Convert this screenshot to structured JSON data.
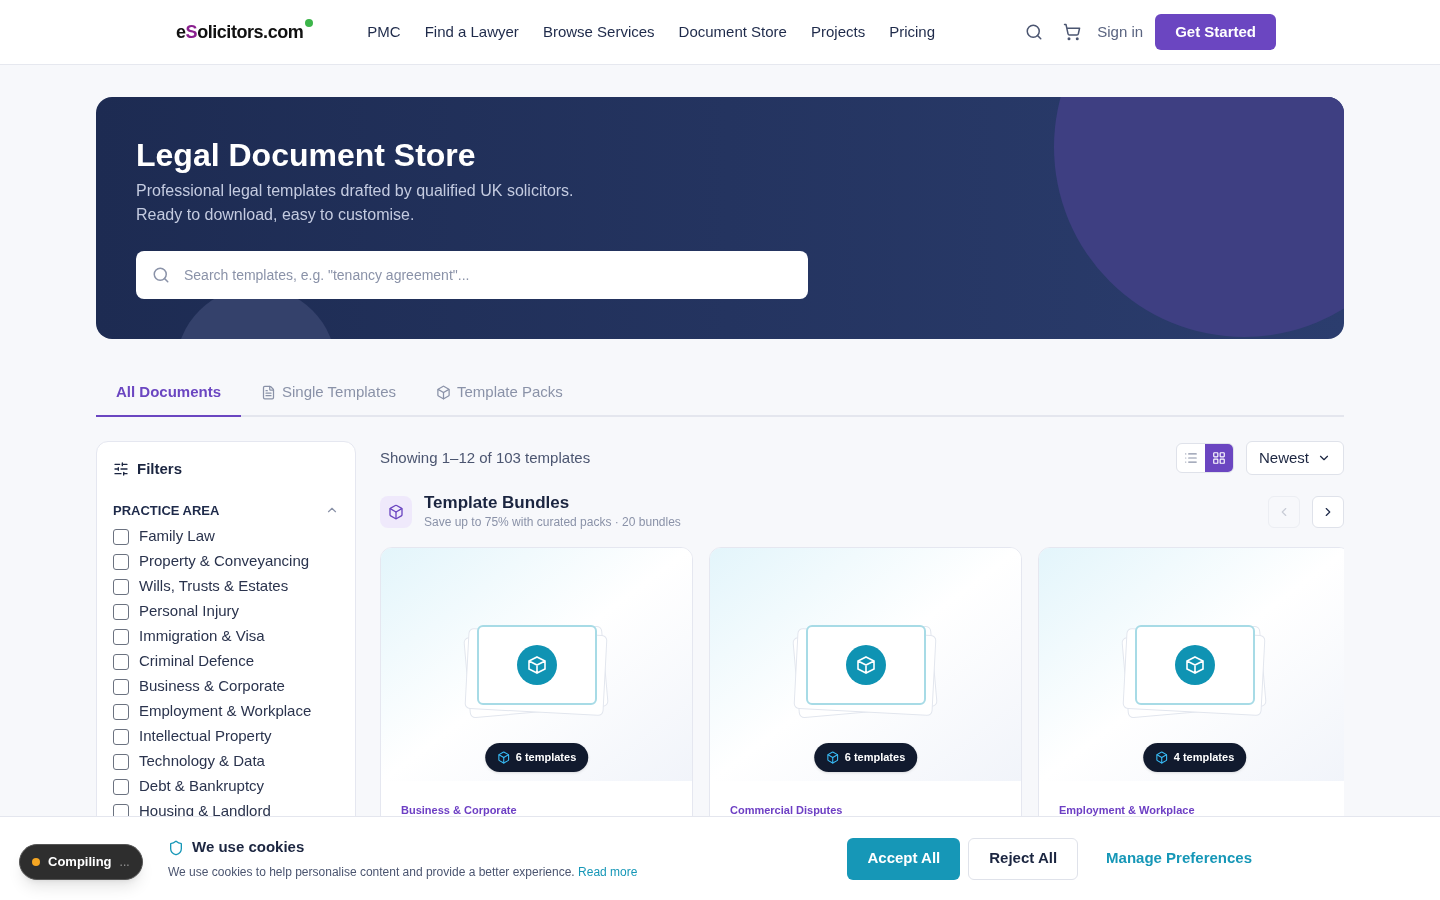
{
  "header": {
    "logo": {
      "start": "e",
      "accent": "S",
      "end": "olicitors.com"
    },
    "nav": [
      "PMC",
      "Find a Lawyer",
      "Browse Services",
      "Document Store",
      "Projects",
      "Pricing"
    ],
    "sign_in": "Sign in",
    "cta": "Get Started"
  },
  "hero": {
    "title": "Legal Document Store",
    "subtitle": [
      "Professional legal templates drafted by qualified UK solicitors.",
      "Ready to download, easy to customise."
    ],
    "search": {
      "placeholder": "Search templates, e.g. \"tenancy agreement\"..."
    }
  },
  "tabs": [
    {
      "label": "All Documents",
      "kind": "all",
      "selected": true
    },
    {
      "label": "Single Templates",
      "kind": "single",
      "selected": false
    },
    {
      "label": "Template Packs",
      "kind": "pack",
      "selected": false
    }
  ],
  "filters": {
    "title": "Filters",
    "section": "PRACTICE AREA",
    "expanded": true,
    "items": [
      {
        "label": "Family Law",
        "checked": false
      },
      {
        "label": "Property & Conveyancing",
        "checked": false
      },
      {
        "label": "Wills, Trusts & Estates",
        "checked": false
      },
      {
        "label": "Personal Injury",
        "checked": false
      },
      {
        "label": "Immigration & Visa",
        "checked": false
      },
      {
        "label": "Criminal Defence",
        "checked": false
      },
      {
        "label": "Business & Corporate",
        "checked": false
      },
      {
        "label": "Employment & Workplace",
        "checked": false
      },
      {
        "label": "Intellectual Property",
        "checked": false
      },
      {
        "label": "Technology & Data",
        "checked": false
      },
      {
        "label": "Debt & Bankruptcy",
        "checked": false
      },
      {
        "label": "Housing & Landlord",
        "checked": false
      }
    ]
  },
  "results": {
    "count": "Showing 1–12 of 103 templates",
    "views": [
      {
        "kind": "list",
        "selected": false
      },
      {
        "kind": "grid",
        "selected": true
      }
    ],
    "sort": "Newest"
  },
  "bundles": {
    "title": "Template Bundles",
    "subtitle": "Save up to 75% with curated packs · 20 bundles",
    "prev_disabled": true,
    "next_disabled": false,
    "cards": [
      {
        "count": "6 templates",
        "category": "Business & Corporate"
      },
      {
        "count": "6 templates",
        "category": "Commercial Disputes"
      },
      {
        "count": "4 templates",
        "category": "Employment & Workplace"
      }
    ]
  },
  "cookie": {
    "title": "We use cookies",
    "text": "We use cookies to help personalise content and provide a better experience.",
    "link": "Read more",
    "accept": "Accept All",
    "reject": "Reject All",
    "manage": "Manage Preferences"
  },
  "status": {
    "label": "Compiling",
    "dots": "..."
  }
}
